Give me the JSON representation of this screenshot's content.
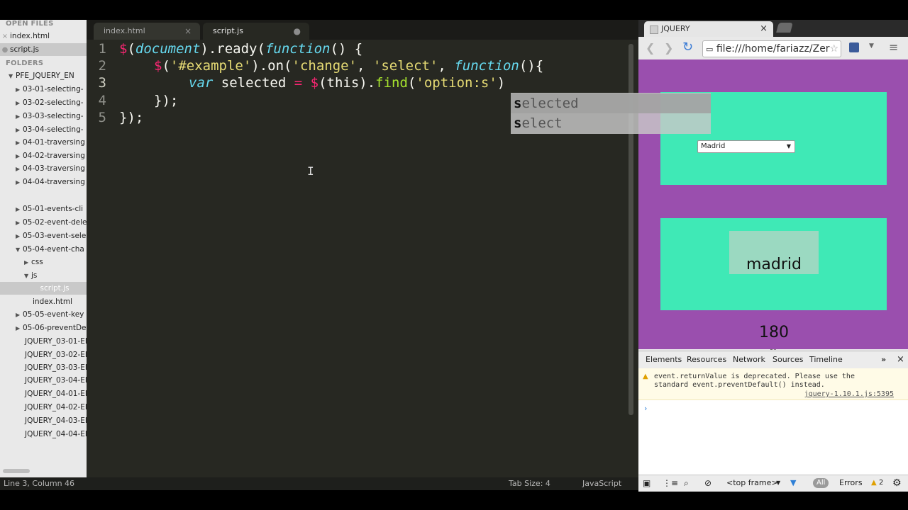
{
  "sidebar": {
    "open_files_header": "OPEN FILES",
    "open_files": [
      {
        "label": "index.html",
        "marker": "×"
      },
      {
        "label": "script.js",
        "marker": "●"
      }
    ],
    "folders_header": "FOLDERS",
    "root": "PFE_JQUERY_EN",
    "items": [
      "03-01-selecting-",
      "03-02-selecting-",
      "03-03-selecting-",
      "03-04-selecting-",
      "04-01-traversing",
      "04-02-traversing",
      "04-03-traversing",
      "04-04-traversing",
      "05-01-events-cli",
      "05-02-event-dele",
      "05-03-event-sele",
      "05-04-event-cha"
    ],
    "sub_css": "css",
    "sub_js": "js",
    "file_script": "script.js",
    "file_index": "index.html",
    "items_after": [
      "05-05-event-key",
      "05-06-preventDe"
    ],
    "files": [
      "JQUERY_03-01-EI",
      "JQUERY_03-02-EI",
      "JQUERY_03-03-EI",
      "JQUERY_03-04-EI",
      "JQUERY_04-01-EI",
      "JQUERY_04-02-EI",
      "JQUERY_04-03-EI",
      "JQUERY_04-04-EI"
    ]
  },
  "editor": {
    "tabs": [
      {
        "label": "index.html",
        "marker": "×"
      },
      {
        "label": "script.js",
        "marker": "●"
      }
    ],
    "line_numbers": [
      "1",
      "2",
      "3",
      "4",
      "5"
    ],
    "code": {
      "l1_a": "$",
      "l1_b": "(",
      "l1_c": "document",
      "l1_d": ").ready(",
      "l1_e": "function",
      "l1_f": "() {",
      "l2_a": "$",
      "l2_b": "(",
      "l2_c": "'#example'",
      "l2_d": ").on(",
      "l2_e": "'change'",
      "l2_f": ", ",
      "l2_g": "'select'",
      "l2_h": ", ",
      "l2_i": "function",
      "l2_j": "(){",
      "l3_a": "var",
      "l3_b": " selected ",
      "l3_c": "=",
      "l3_d": " ",
      "l3_e": "$",
      "l3_f": "(this).",
      "l3_g": "find",
      "l3_h": "(",
      "l3_i": "'option:s'",
      "l3_j": ")",
      "l4": "});",
      "l5": "});"
    },
    "autocomplete": [
      {
        "match": "s",
        "rest": "elected"
      },
      {
        "match": "s",
        "rest": "elect"
      }
    ],
    "ibeam": "I"
  },
  "status": {
    "position": "Line 3, Column 46",
    "tab_size": "Tab Size: 4",
    "syntax": "JavaScript"
  },
  "browser": {
    "tab_title": "JQUERY",
    "tab_close": "×",
    "url": "file:///home/fariazz/Zer",
    "select_value": "Madrid",
    "output_text": "madrid 180",
    "colors": {
      "page_bg": "#9a4fae",
      "box": "#3fe9b6",
      "output_bg": "#9bd9c1"
    }
  },
  "devtools": {
    "tabs": [
      "Elements",
      "Resources",
      "Network",
      "Sources",
      "Timeline"
    ],
    "more": "»",
    "close": "×",
    "warning": "event.returnValue is deprecated. Please use the standard event.preventDefault() instead.",
    "warning_source": "jquery-1.10.1.js:5395",
    "prompt": "›",
    "frame": "<top frame>",
    "filter_all": "All",
    "errors_label": "Errors",
    "warning_count": "2"
  }
}
